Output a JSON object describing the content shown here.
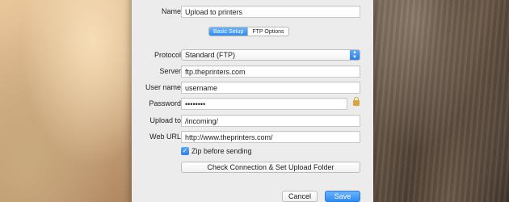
{
  "dialog": {
    "name_label": "Name",
    "name_value": "Upload to printers",
    "tabs": [
      {
        "label": "Basic Setup",
        "active": true
      },
      {
        "label": "FTP Options",
        "active": false
      }
    ],
    "protocol_label": "Protocol",
    "protocol_value": "Standard (FTP)",
    "server_label": "Server",
    "server_value": "ftp.theprinters.com",
    "username_label": "User name",
    "username_value": "username",
    "password_label": "Password",
    "password_value": "••••••••",
    "upload_to_label": "Upload to",
    "upload_to_value": "/incoming/",
    "web_url_label": "Web URL",
    "web_url_value": "http://www.theprinters.com/",
    "zip_label": "Zip before sending",
    "zip_checked": true,
    "check_button_label": "Check Connection & Set Upload Folder",
    "cancel_label": "Cancel",
    "save_label": "Save"
  },
  "colors": {
    "accent": "#2f8cf3",
    "dialog_bg": "#ececec"
  },
  "icons": [
    "lock-icon",
    "select-arrows-icon",
    "checkmark-icon"
  ]
}
